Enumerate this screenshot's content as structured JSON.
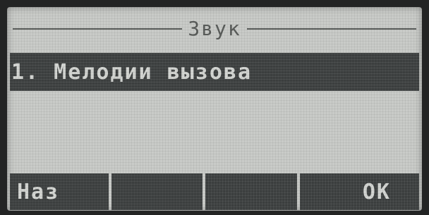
{
  "screen": {
    "title": "Звук"
  },
  "menu": {
    "items": [
      {
        "label": "1. Мелодии вызова",
        "selected": true
      }
    ]
  },
  "softkeys": [
    {
      "label": "Наз"
    },
    {
      "label": ""
    },
    {
      "label": ""
    },
    {
      "label": "OK"
    }
  ]
}
